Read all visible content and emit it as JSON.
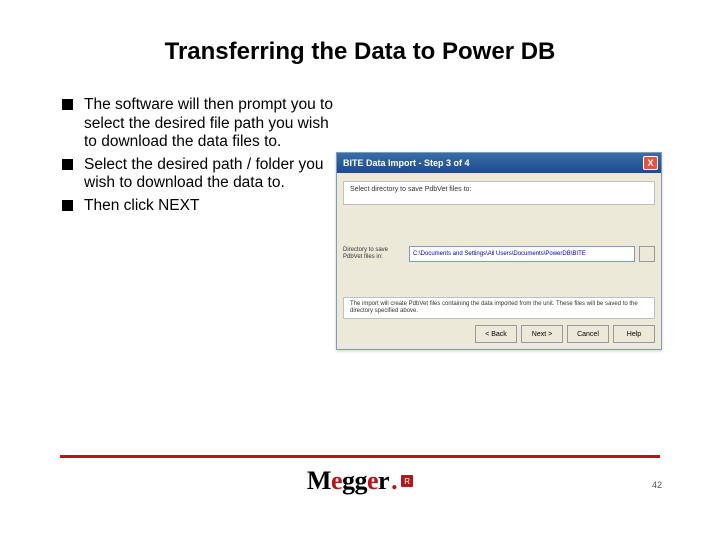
{
  "title": "Transferring the Data to Power DB",
  "bullets": [
    "The software will then prompt you to select the desired file path you wish to download the data files to.",
    "Select the desired path / folder you wish to download the data to.",
    "Then click NEXT"
  ],
  "dialog": {
    "title": "BITE Data Import - Step 3 of 4",
    "close": "X",
    "instruction": "Select directory to save PdbVet files to:",
    "field_label": "Directory to save PdbVet files in:",
    "path_value": "C:\\Documents and Settings\\All Users\\Documents\\PowerDB\\BITE",
    "note": "The import will create PdbVet files containing the data imported from the unit. These files will be saved to the directory specified above.",
    "buttons": {
      "back": "< Back",
      "next": "Next >",
      "cancel": "Cancel",
      "help": "Help"
    }
  },
  "logo": {
    "part1": "M",
    "part2": "e",
    "part3": "gg",
    "part4": "e",
    "part5": "r",
    "dot": ".",
    "reg": "R"
  },
  "page_number": "42"
}
